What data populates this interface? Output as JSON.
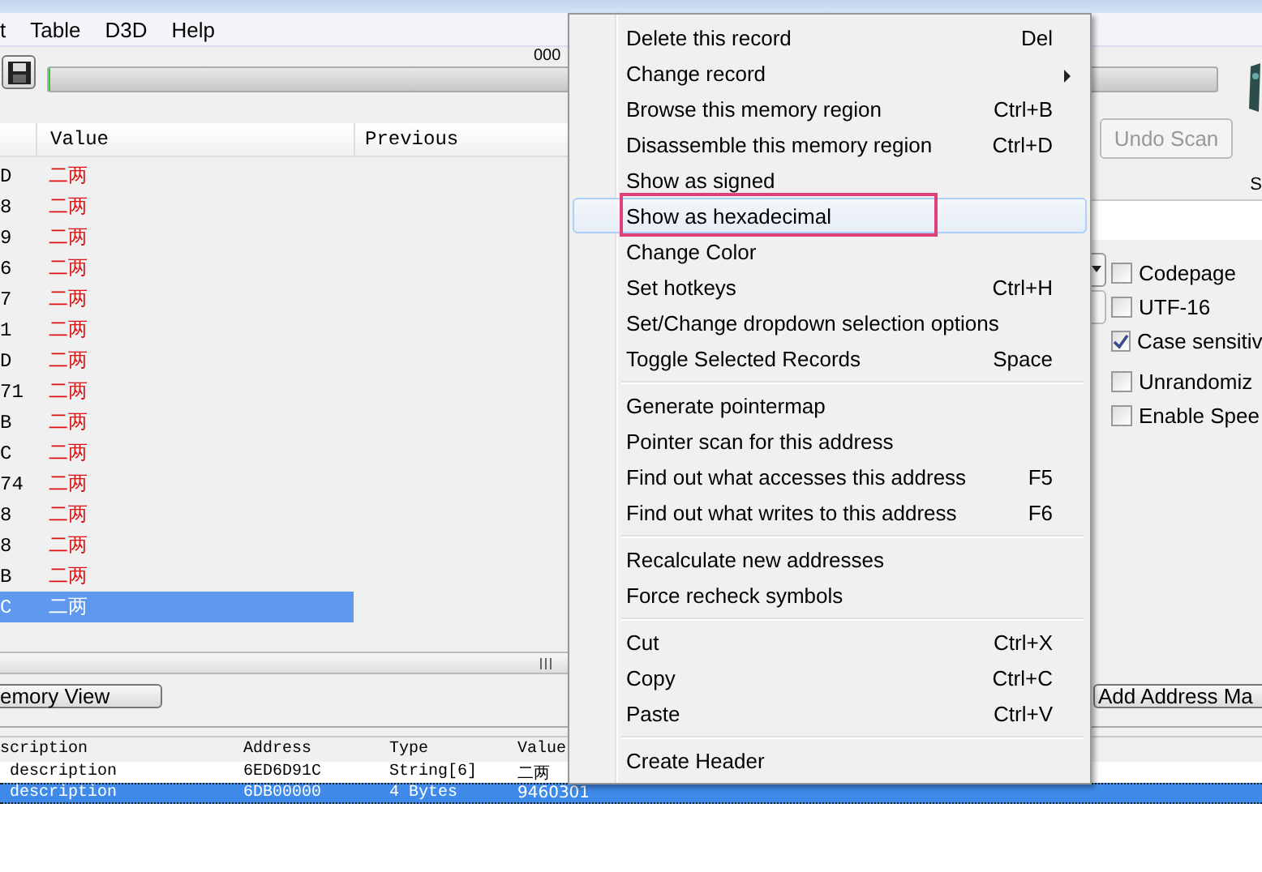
{
  "menu_bar": [
    "t",
    "Table",
    "D3D",
    "Help"
  ],
  "toolbar": {
    "progress_text": "000",
    "progress": {
      "level": 0
    }
  },
  "found_list": {
    "columns": [
      "Value",
      "Previous"
    ],
    "rows": [
      {
        "address": "D",
        "value": "二两",
        "selected": false
      },
      {
        "address": "8",
        "value": "二两",
        "selected": false
      },
      {
        "address": "9",
        "value": "二两",
        "selected": false
      },
      {
        "address": "6",
        "value": "二两",
        "selected": false
      },
      {
        "address": "7",
        "value": "二两",
        "selected": false
      },
      {
        "address": "1",
        "value": "二两",
        "selected": false
      },
      {
        "address": "D",
        "value": "二两",
        "selected": false
      },
      {
        "address": "71",
        "value": "二两",
        "selected": false
      },
      {
        "address": "B",
        "value": "二两",
        "selected": false
      },
      {
        "address": "C",
        "value": "二两",
        "selected": false
      },
      {
        "address": "74",
        "value": "二两",
        "selected": false
      },
      {
        "address": "8",
        "value": "二两",
        "selected": false
      },
      {
        "address": "8",
        "value": "二两",
        "selected": false
      },
      {
        "address": "B",
        "value": "二两",
        "selected": false
      },
      {
        "address": "C",
        "value": "二两",
        "selected": true
      }
    ]
  },
  "scan_panel": {
    "undo_button": "Undo Scan",
    "label": "S",
    "options": [
      {
        "label": "Codepage",
        "checked": false
      },
      {
        "label": "UTF-16",
        "checked": false
      },
      {
        "label": "Case sensitiv",
        "checked": true
      },
      {
        "label": "Unrandomiz",
        "checked": false
      },
      {
        "label": "Enable Spee",
        "checked": false
      }
    ]
  },
  "memory_view_button": "emory View",
  "add_address_button": "Add Address Ma",
  "address_list": {
    "columns": [
      "scription",
      "Address",
      "Type",
      "Value"
    ],
    "rows": [
      {
        "cells": [
          "description",
          "6ED6D91C",
          "String[6]",
          "二两"
        ],
        "selected": false
      },
      {
        "cells": [
          "description",
          "6DB00000",
          "4 Bytes",
          "9460301"
        ],
        "selected": true
      }
    ]
  },
  "context_menu": [
    {
      "kind": "item",
      "label": "Delete this record",
      "shortcut": "Del",
      "selected": false
    },
    {
      "kind": "submenu",
      "label": "Change record",
      "selected": false
    },
    {
      "kind": "item",
      "label": "Browse this memory region",
      "shortcut": "Ctrl+B",
      "selected": false
    },
    {
      "kind": "item",
      "label": "Disassemble this memory region",
      "shortcut": "Ctrl+D",
      "selected": false
    },
    {
      "kind": "item",
      "label": "Show as signed",
      "selected": false
    },
    {
      "kind": "item",
      "label": "Show as hexadecimal",
      "selected": true
    },
    {
      "kind": "item",
      "label": "Change Color",
      "selected": false
    },
    {
      "kind": "item",
      "label": "Set hotkeys",
      "shortcut": "Ctrl+H",
      "selected": false
    },
    {
      "kind": "item",
      "label": "Set/Change dropdown selection options",
      "selected": false
    },
    {
      "kind": "item",
      "label": "Toggle Selected Records",
      "shortcut": "Space",
      "selected": false
    },
    {
      "kind": "separator"
    },
    {
      "kind": "item",
      "label": "Generate pointermap",
      "selected": false
    },
    {
      "kind": "item",
      "label": "Pointer scan for this address",
      "selected": false
    },
    {
      "kind": "item",
      "label": "Find out what accesses this address",
      "shortcut": "F5",
      "selected": false
    },
    {
      "kind": "item",
      "label": "Find out what writes to this address",
      "shortcut": "F6",
      "selected": false
    },
    {
      "kind": "separator"
    },
    {
      "kind": "item",
      "label": "Recalculate new addresses",
      "selected": false
    },
    {
      "kind": "item",
      "label": "Force recheck symbols",
      "selected": false
    },
    {
      "kind": "separator"
    },
    {
      "kind": "item",
      "label": "Cut",
      "shortcut": "Ctrl+X",
      "selected": false
    },
    {
      "kind": "item",
      "label": "Copy",
      "shortcut": "Ctrl+C",
      "selected": false
    },
    {
      "kind": "item",
      "label": "Paste",
      "shortcut": "Ctrl+V",
      "selected": false
    },
    {
      "kind": "separator"
    },
    {
      "kind": "item",
      "label": "Create Header",
      "selected": false
    }
  ]
}
